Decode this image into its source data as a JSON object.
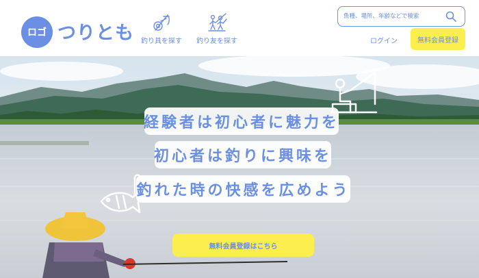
{
  "header": {
    "logo_mark": "ロゴ",
    "logo_text": "つりとも",
    "nav": [
      {
        "label": "釣り具を探す",
        "icon": "fishing-rod-icon"
      },
      {
        "label": "釣り友を探す",
        "icon": "fishing-friends-icon"
      }
    ],
    "search": {
      "placeholder": "魚種、場所、年齢などで検索",
      "icon": "search-icon"
    },
    "login_label": "ログイン",
    "signup_label": "無料会員登録"
  },
  "hero": {
    "taglines": [
      "経験者は初心者に魅力を",
      "初心者は釣りに興味を",
      "釣れた時の快感を広めよう"
    ],
    "cta_label": "無料会員登録はこちら",
    "illustrations": [
      "angler-line-icon",
      "fish-line-icon"
    ]
  },
  "colors": {
    "accent": "#6b8fe3",
    "button": "#fbee4e",
    "background": "#ffffff"
  }
}
